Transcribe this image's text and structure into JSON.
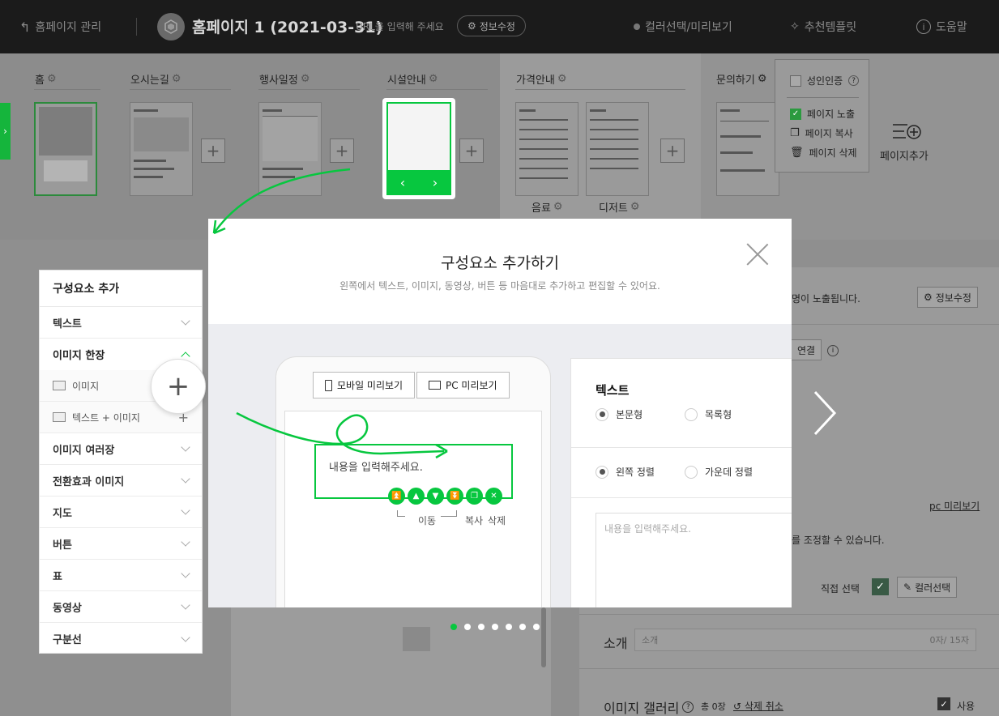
{
  "topbar": {
    "back_label": "홈페이지 관리",
    "site_title": "홈페이지 1 (2021-03-31)",
    "url_hint": "URL을 입력해 주세요",
    "info_edit_label": "정보수정",
    "color_preview_label": "컬러선택/미리보기",
    "template_label": "추천템플릿",
    "help_label": "도움말"
  },
  "pages": {
    "home": "홈",
    "directions": "오시는길",
    "schedule": "행사일정",
    "facilities": "시설안내",
    "pricing": "가격안내",
    "contact": "문의하기",
    "drinks": "음료",
    "dessert": "디저트",
    "add_page": "페이지추가"
  },
  "page_menu": {
    "adult": "성인인증",
    "show": "페이지 노출",
    "copy": "페이지 복사",
    "delete": "페이지 삭제"
  },
  "components": {
    "title": "구성요소 추가",
    "items": [
      "텍스트",
      "이미지 한장",
      "이미지 여러장",
      "전환효과 이미지",
      "지도",
      "버튼",
      "표",
      "동영상",
      "구분선"
    ],
    "sub_image": "이미지",
    "sub_text_image": "텍스트 + 이미지"
  },
  "modal": {
    "title": "구성요소 추가하기",
    "desc": "왼쪽에서 텍스트, 이미지, 동영상, 버튼 등 마음대로 추가하고 편집할 수 있어요.",
    "mobile_preview": "모바일 미리보기",
    "pc_preview": "PC 미리보기",
    "content_placeholder": "내용을 입력해주세요.",
    "move_label": "이동",
    "copy_label": "복사",
    "delete_label": "삭제",
    "form_title": "텍스트",
    "body_style": "본문형",
    "list_style": "목록형",
    "align_left": "왼쪽 정렬",
    "align_center": "가운데 정렬",
    "textarea_placeholder": "내용을 입력해주세요."
  },
  "right_panel": {
    "expose_text": "명이 노출됩니다.",
    "info_edit": "정보수정",
    "connect": "연결",
    "pc_preview_link": "pc 미리보기",
    "adjust_text": "를 조정할 수 있습니다.",
    "direct_select": "직접 선택",
    "color_select": "컬러선택",
    "intro_label": "소개",
    "intro_placeholder": "소개",
    "intro_count": "0자/ 15자",
    "gallery_label": "이미지 갤러리",
    "gallery_count": "총 0장",
    "undo_delete": "삭제 취소",
    "use_label": "사용"
  },
  "colors": {
    "accent": "#07c73f"
  }
}
